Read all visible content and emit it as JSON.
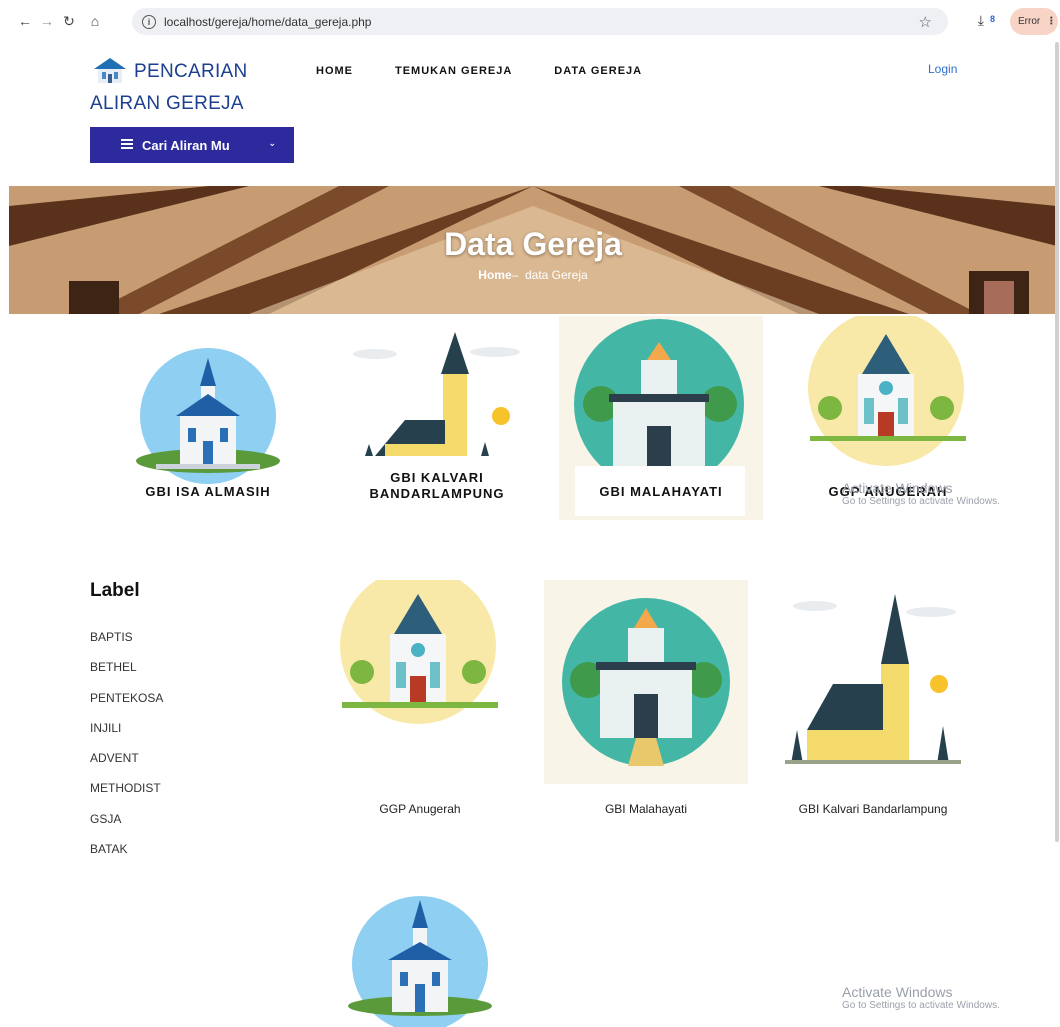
{
  "browser": {
    "url": "localhost/gereja/home/data_gereja.php",
    "error_label": "Error"
  },
  "header": {
    "logo_text": "PENCARIAN ALIRAN GEREJA",
    "nav": [
      "HOME",
      "TEMUKAN GEREJA",
      "DATA GEREJA"
    ],
    "login": "Login",
    "search_dropdown": "Cari Aliran Mu"
  },
  "hero": {
    "title": "Data Gereja",
    "crumb_home": "Home",
    "crumb_sep": "–",
    "crumb_current": "data Gereja"
  },
  "featured": [
    {
      "label": "GBI ISA ALMASIH",
      "style": "blue-church"
    },
    {
      "label": "GBI KALVARI BANDARLAMPUNG",
      "style": "yellow-tower"
    },
    {
      "label": "GBI MALAHAYATI",
      "style": "green-cathedral"
    },
    {
      "label": "GGP ANUGERAH",
      "style": "sun-church"
    }
  ],
  "sidebar": {
    "title": "Label",
    "items": [
      "BAPTIS",
      "BETHEL",
      "PENTEKOSA",
      "INJILI",
      "ADVENT",
      "METHODIST",
      "GSJA",
      "BATAK"
    ]
  },
  "results": [
    {
      "name": "GGP Anugerah",
      "style": "sun-church"
    },
    {
      "name": "GBI Malahayati",
      "style": "green-cathedral"
    },
    {
      "name": "GBI Kalvari Bandarlampung",
      "style": "yellow-tower"
    },
    {
      "name": "",
      "style": "blue-church"
    }
  ],
  "watermark": {
    "title": "Activate Windows",
    "sub": "Go to Settings to activate Windows."
  }
}
